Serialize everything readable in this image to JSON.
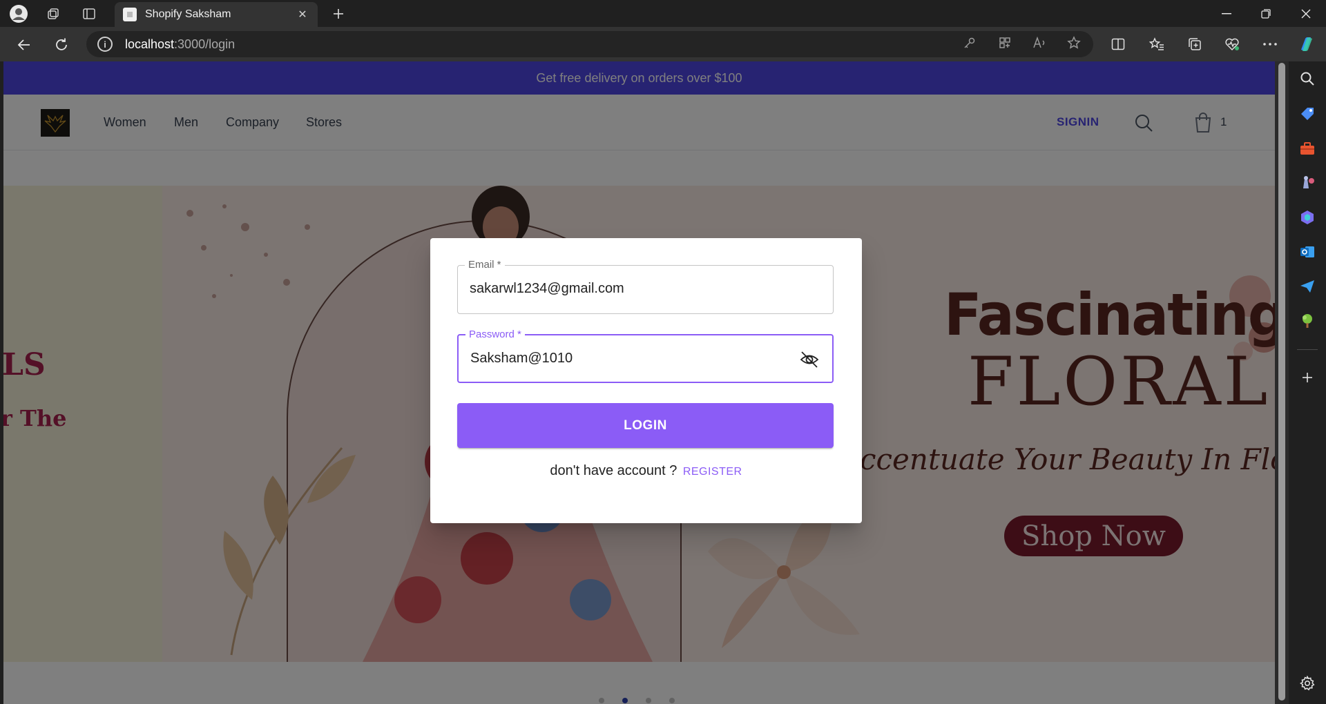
{
  "browser": {
    "tab_title": "Shopify Saksham",
    "url_host": "localhost",
    "url_rest": ":3000/login"
  },
  "site": {
    "promo": "Get free delivery on orders over $100",
    "nav": [
      "Women",
      "Men",
      "Company",
      "Stores"
    ],
    "signin": "SIGNIN",
    "cart_count": "1"
  },
  "hero": {
    "left_text1": "LS",
    "left_text2": "r The",
    "title1": "Fascinating",
    "title2": "FLORAL",
    "tagline": "ccentuate Your Beauty In Floral (",
    "cta": "Shop Now",
    "slide_count": 4,
    "active_slide": 2
  },
  "login": {
    "email_label": "Email *",
    "email_value": "sakarwl1234@gmail.com",
    "password_label": "Password *",
    "password_value": "Saksham@1010",
    "submit": "LOGIN",
    "register_prompt": "don't have account ?",
    "register_link": "REGISTER"
  },
  "colors": {
    "promo_bg": "#4f46e5",
    "accent": "#8b5cf6",
    "brand_text": "#4f46e5",
    "cta_bg": "#7a1a2c"
  }
}
